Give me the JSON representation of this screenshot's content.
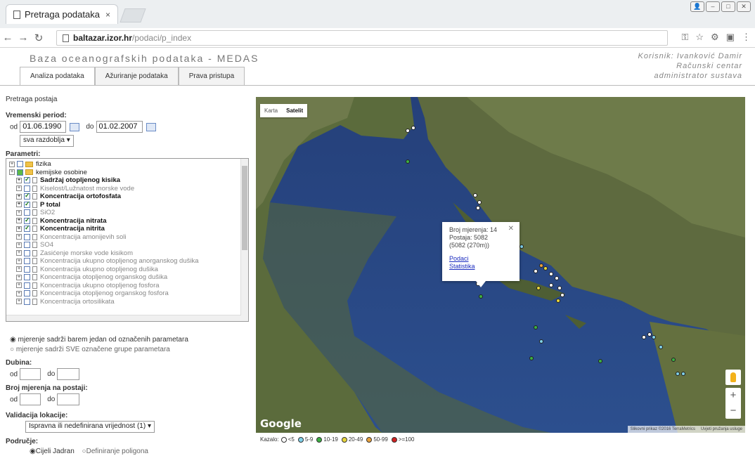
{
  "browser": {
    "tab_title": "Pretraga podataka",
    "tab_close": "×",
    "url_host": "baltazar.izor.hr",
    "url_path": "/podaci/p_index"
  },
  "app": {
    "title": "Baza oceanografskih podataka - MEDAS",
    "user_line1": "Korisnik: Ivanković Damir",
    "user_line2": "Računski centar",
    "user_line3": "administrator sustava",
    "tabs": [
      "Analiza podataka",
      "Ažuriranje podataka",
      "Prava pristupa"
    ]
  },
  "search": {
    "heading": "Pretraga postaja",
    "period_label": "Vremenski period:",
    "from_label": "od",
    "from_value": "01.06.1990",
    "to_label": "do",
    "to_value": "01.02.2007",
    "period_select": "sva razdoblja ▾",
    "params_label": "Parametri:",
    "tree": [
      {
        "label": "fizika",
        "type": "folder",
        "state": "off",
        "indent": 0
      },
      {
        "label": "kemijske osobine",
        "type": "folder",
        "state": "part",
        "indent": 0
      },
      {
        "label": "Sadržaj otopljenog kisika",
        "type": "doc",
        "state": "on",
        "indent": 1
      },
      {
        "label": "Kiselost/Lužnatost morske vode",
        "type": "doc",
        "state": "off",
        "indent": 1
      },
      {
        "label": "Koncentracija ortofosfata",
        "type": "doc",
        "state": "on",
        "indent": 1
      },
      {
        "label": "P total",
        "type": "doc",
        "state": "on",
        "indent": 1
      },
      {
        "label": "SiO2",
        "type": "doc",
        "state": "off",
        "indent": 1
      },
      {
        "label": "Koncentracija nitrata",
        "type": "doc",
        "state": "on",
        "indent": 1
      },
      {
        "label": "Koncentracija nitrita",
        "type": "doc",
        "state": "on",
        "indent": 1
      },
      {
        "label": "Koncentracija amonijevih soli",
        "type": "doc",
        "state": "off",
        "indent": 1
      },
      {
        "label": "SO4",
        "type": "doc",
        "state": "off",
        "indent": 1
      },
      {
        "label": "Zasićenje morske vode kisikom",
        "type": "doc",
        "state": "off",
        "indent": 1
      },
      {
        "label": "Koncentracija ukupno otopljenog anorganskog dušika",
        "type": "doc",
        "state": "off",
        "indent": 1
      },
      {
        "label": "Koncentracija ukupno otopljenog dušika",
        "type": "doc",
        "state": "off",
        "indent": 1
      },
      {
        "label": "Koncentracija otopljenog organskog dušika",
        "type": "doc",
        "state": "off",
        "indent": 1
      },
      {
        "label": "Koncentracija ukupno otopljenog fosfora",
        "type": "doc",
        "state": "off",
        "indent": 1
      },
      {
        "label": "Koncentracija otopljenog organskog fosfora",
        "type": "doc",
        "state": "off",
        "indent": 1
      },
      {
        "label": "Koncentracija ortosilikata",
        "type": "doc",
        "state": "off",
        "indent": 1
      }
    ],
    "radio1": "mjerenje sadrži barem jedan od označenih parametara",
    "radio2": "mjerenje sadrži SVE označene grupe parametara",
    "depth_label": "Dubina:",
    "count_label": "Broj mjerenja na postaji:",
    "od": "od",
    "do": "do",
    "validation_label": "Validacija lokacije:",
    "validation_value": "Ispravna ili nedefinirana vrijednost (1) ▾",
    "area_label": "Područje:",
    "area_opt1": "Cijeli Jadran",
    "area_opt2": "Definiranje poligona"
  },
  "map": {
    "type_map": "Karta",
    "type_sat": "Satelit",
    "google": "Google",
    "attribution": "Slikovni prikaz ©2016 TerraMetrics",
    "terms": "Uvjeti pružanja usluge",
    "popup": {
      "line1": "Broj mjerenja: 14",
      "line2": "Postaja: 5082",
      "line3": "(5082 (270m))",
      "link1": "Podaci",
      "link2": "Statistika",
      "close": "✕"
    }
  },
  "legend": {
    "title": "Kazalo:",
    "items": [
      {
        "label": "<5",
        "color": "#ffffff"
      },
      {
        "label": "5-9",
        "color": "#7fd0e8"
      },
      {
        "label": "10-19",
        "color": "#3cb043"
      },
      {
        "label": "20-49",
        "color": "#e8d63c"
      },
      {
        "label": "50-99",
        "color": "#e8a13c"
      },
      {
        "label": ">=100",
        "color": "#d02020"
      }
    ]
  }
}
